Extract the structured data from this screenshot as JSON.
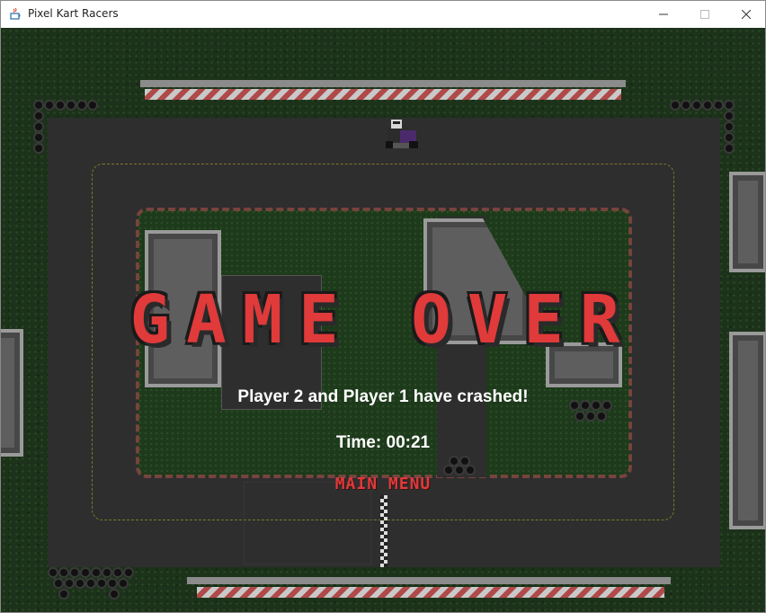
{
  "window": {
    "title": "Pixel Kart Racers",
    "controls": [
      "minimize-icon",
      "maximize-icon",
      "close-icon"
    ]
  },
  "game_over": {
    "title": "GAME OVER",
    "message": "Player 2 and Player 1 have crashed!",
    "time_label": "Time:",
    "time_value": "00:21",
    "main_menu_label": "MAIN MENU"
  },
  "colors": {
    "accent_red": "#e03a3a",
    "grass": "#1c321a",
    "asphalt": "#2e2e2e"
  }
}
